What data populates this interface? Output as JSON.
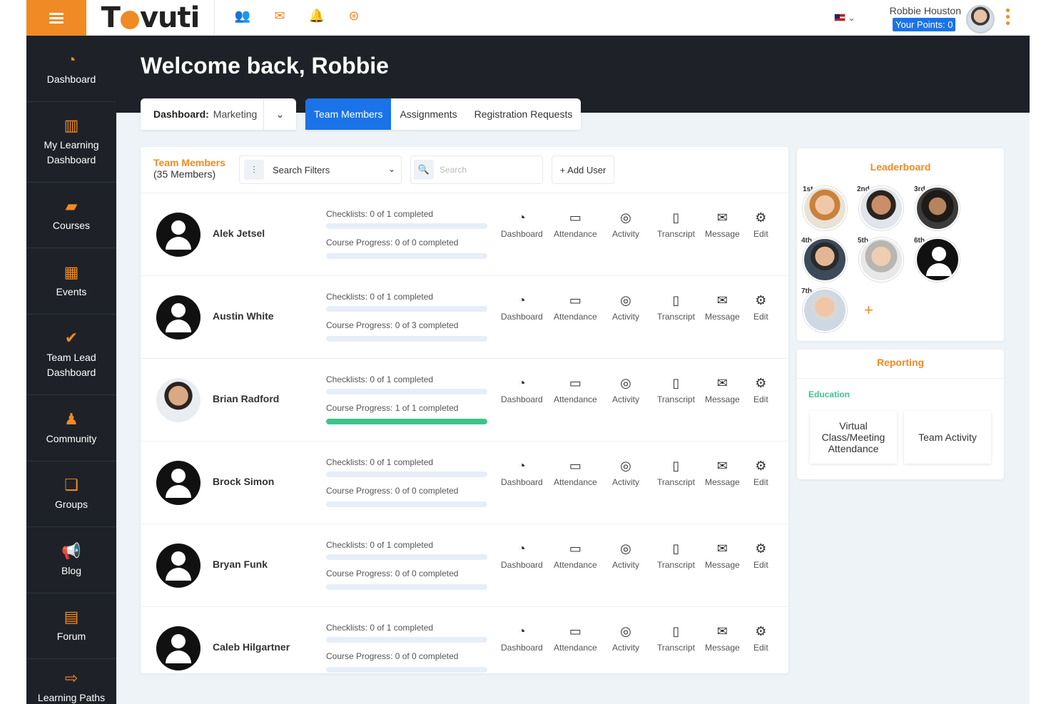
{
  "topbar": {
    "logo": "Tovuti",
    "icons": [
      "team-icon",
      "mail-icon",
      "bell-icon",
      "rewards-icon"
    ],
    "user_name": "Robbie Houston",
    "points": "Your Points: 0",
    "language_icon": "us-flag-icon"
  },
  "sidebar": {
    "items": [
      {
        "label": "Dashboard",
        "icon": "dashboard-icon",
        "glyph": "◔"
      },
      {
        "label": "My Learning Dashboard",
        "icon": "books-icon",
        "glyph": "▥"
      },
      {
        "label": "Courses",
        "icon": "book-icon",
        "glyph": "▰"
      },
      {
        "label": "Events",
        "icon": "calendar-icon",
        "glyph": "▦"
      },
      {
        "label": "Team Lead Dashboard",
        "icon": "clipboard-check-icon",
        "glyph": "✔"
      },
      {
        "label": "Community",
        "icon": "community-icon",
        "glyph": "♟"
      },
      {
        "label": "Groups",
        "icon": "groups-chat-icon",
        "glyph": "❏"
      },
      {
        "label": "Blog",
        "icon": "megaphone-icon",
        "glyph": "📢"
      },
      {
        "label": "Forum",
        "icon": "forum-icon",
        "glyph": "▤"
      },
      {
        "label": "Learning Paths",
        "icon": "learning-paths-icon",
        "glyph": "⇨"
      }
    ]
  },
  "header": {
    "welcome": "Welcome back, Robbie",
    "dashboard_label": "Dashboard:",
    "dashboard_value": "Marketing",
    "tabs": [
      "Team Members",
      "Assignments",
      "Registration Requests"
    ],
    "active_tab": "Team Members"
  },
  "members_panel": {
    "title": "Team Members",
    "count": "(35 Members)",
    "filter_label": "Search Filters",
    "search_placeholder": "Search",
    "add_user": "+ Add User",
    "action_labels": [
      "Dashboard",
      "Attendance",
      "Activity",
      "Transcript",
      "Message",
      "Edit"
    ],
    "rows": [
      {
        "name": "Alek Jetsel",
        "checklists": "Checklists: 0 of 1 completed",
        "course_progress": "Course Progress: 0 of 0 completed",
        "progress": 0,
        "photo": false
      },
      {
        "name": "Austin White",
        "checklists": "Checklists: 0 of 1 completed",
        "course_progress": "Course Progress: 0 of 3 completed",
        "progress": 0,
        "photo": false
      },
      {
        "name": "Brian Radford",
        "checklists": "Checklists: 0 of 1 completed",
        "course_progress": "Course Progress: 1 of 1 completed",
        "progress": 1,
        "photo": true
      },
      {
        "name": "Brock Simon",
        "checklists": "Checklists: 0 of 1 completed",
        "course_progress": "Course Progress: 0 of 0 completed",
        "progress": 0,
        "photo": false
      },
      {
        "name": "Bryan Funk",
        "checklists": "Checklists: 0 of 1 completed",
        "course_progress": "Course Progress: 0 of 0 completed",
        "progress": 0,
        "photo": false
      },
      {
        "name": "Caleb Hilgartner",
        "checklists": "Checklists: 0 of 1 completed",
        "course_progress": "Course Progress: 0 of 0 completed",
        "progress": 0,
        "photo": false
      }
    ]
  },
  "leaderboard": {
    "title": "Leaderboard",
    "ranks": [
      "1st",
      "2nd",
      "3rd",
      "4th",
      "5th",
      "6th",
      "7th"
    ]
  },
  "reporting": {
    "title": "Reporting",
    "category": "Education",
    "cards": [
      "Virtual Class/Meeting Attendance",
      "Team Activity"
    ]
  },
  "colors": {
    "accent": "#f08a24",
    "primary": "#1a73e8",
    "sidebar": "#1e2228",
    "success": "#3cc48d"
  }
}
